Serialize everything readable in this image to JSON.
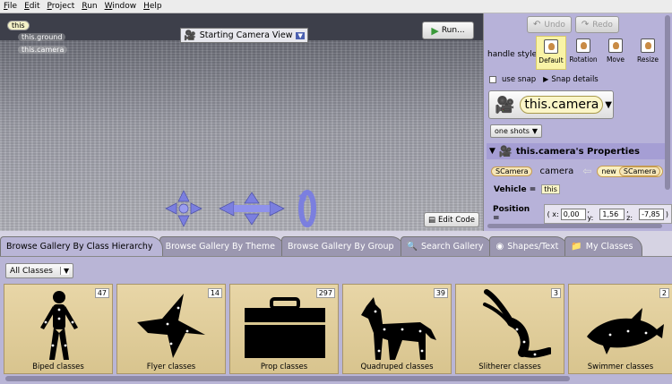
{
  "menubar": [
    "File",
    "Edit",
    "Project",
    "Run",
    "Window",
    "Help"
  ],
  "scene": {
    "this_tag": "this",
    "tags": [
      "this.ground",
      "this.camera"
    ],
    "camera_view": "Starting Camera View",
    "run_label": "Run...",
    "edit_code_label": "Edit Code"
  },
  "panel": {
    "undo": "Undo",
    "redo": "Redo",
    "handle_style_label": "handle style:",
    "handle_options": [
      "Default",
      "Rotation",
      "Move",
      "Resize"
    ],
    "use_snap": "use snap",
    "snap_details": "Snap details",
    "selected_object": "this.camera",
    "one_shots": "one shots",
    "properties_title": "this.camera's Properties",
    "decl_type": "SCamera",
    "decl_name": "camera",
    "new_keyword": "new",
    "vehicle_label": "Vehicle =",
    "vehicle_value": "this",
    "position_label": "Position =",
    "pos_open": "(",
    "x_label": "x:",
    "x_value": "0,00",
    "y_label": ", y:",
    "y_value": "1,56",
    "z_label": ", z:",
    "z_value": "-7,85",
    "pos_close": ")"
  },
  "gallery": {
    "tabs": [
      "Browse Gallery By Class Hierarchy",
      "Browse Gallery By Theme",
      "Browse Gallery By Group",
      "Search Gallery",
      "Shapes/Text",
      "My Classes"
    ],
    "filter": "All Classes",
    "cards": [
      {
        "label": "Biped classes",
        "count": "47"
      },
      {
        "label": "Flyer classes",
        "count": "14"
      },
      {
        "label": "Prop classes",
        "count": "297"
      },
      {
        "label": "Quadruped classes",
        "count": "39"
      },
      {
        "label": "Slitherer classes",
        "count": "3"
      },
      {
        "label": "Swimmer classes",
        "count": "2"
      }
    ]
  },
  "colors": {
    "panel_bg": "#b7b2d9",
    "gallery_bg": "#b9b5d6",
    "card_bg": "#e0cd99",
    "handle_color": "#7b7fdf"
  }
}
